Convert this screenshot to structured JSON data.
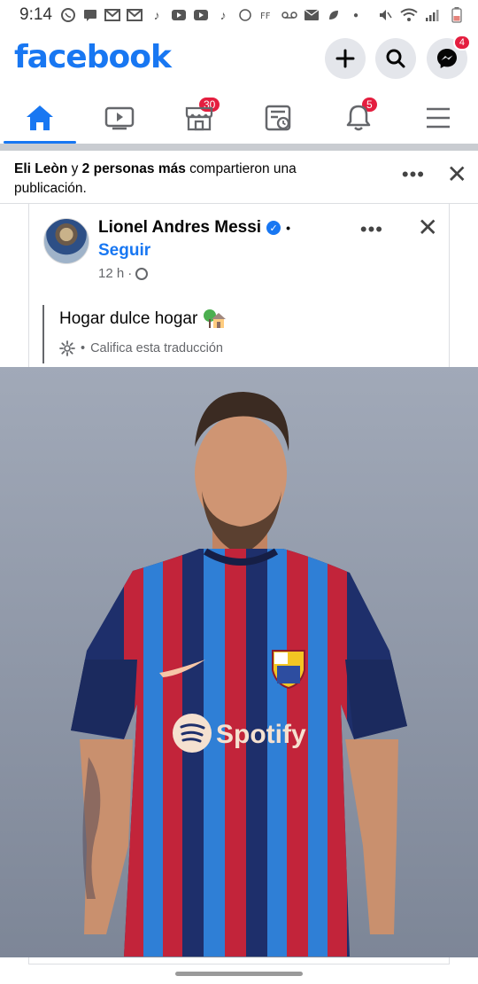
{
  "status_bar": {
    "time": "9:14"
  },
  "header": {
    "brand": "facebook",
    "messenger_badge": "4"
  },
  "tabs": {
    "watch_badge": "30",
    "marketplace_badge": "5"
  },
  "share": {
    "actor": "Eli Leòn",
    "connector": "y",
    "others": "2 personas más",
    "action": "compartieron una publicación."
  },
  "post": {
    "author": "Lionel Andres Messi",
    "follow_label": "Seguir",
    "time": "12 h",
    "text": "Hogar dulce hogar",
    "translate_label": "Califica esta traducción"
  },
  "photo": {
    "shirt_sponsor": "Spotify"
  },
  "colors": {
    "brand": "#1877f2",
    "badge": "#e41e3f"
  }
}
